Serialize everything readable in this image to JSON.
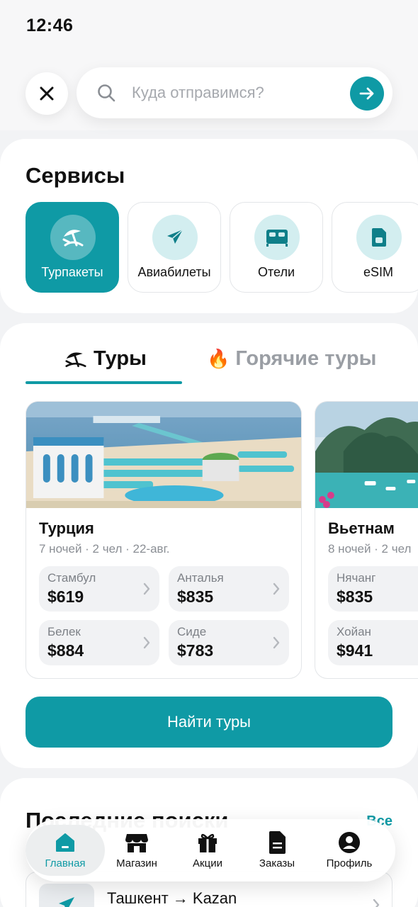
{
  "status_bar": {
    "time": "12:46"
  },
  "search": {
    "placeholder": "Куда отправимся?"
  },
  "services": {
    "title": "Сервисы",
    "items": [
      {
        "label": "Турпакеты",
        "icon": "beach-umbrella-icon",
        "active": true
      },
      {
        "label": "Авиабилеты",
        "icon": "airplane-icon",
        "active": false
      },
      {
        "label": "Отели",
        "icon": "bed-icon",
        "active": false
      },
      {
        "label": "eSIM",
        "icon": "sim-card-icon",
        "active": false
      }
    ]
  },
  "tours_tabs": {
    "tours": "Туры",
    "hot": "Горячие туры",
    "hot_emoji": "🔥"
  },
  "tours": [
    {
      "country": "Турция",
      "meta": "7 ночей · 2 чел · 22-авг.",
      "prices": [
        {
          "city": "Стамбул",
          "price": "$619"
        },
        {
          "city": "Анталья",
          "price": "$835"
        },
        {
          "city": "Белек",
          "price": "$884"
        },
        {
          "city": "Сиде",
          "price": "$783"
        }
      ]
    },
    {
      "country": "Вьетнам",
      "meta": "8 ночей · 2 чел",
      "prices": [
        {
          "city": "Нячанг",
          "price": "$835"
        },
        {
          "city": "Хойан",
          "price": "$941"
        }
      ]
    }
  ],
  "find_button": "Найти туры",
  "recent": {
    "title": "Последние поиски",
    "all_label": "Все",
    "items": [
      {
        "route": "Ташкент → Kazan"
      }
    ]
  },
  "tabbar": [
    {
      "label": "Главная",
      "icon": "home-icon",
      "active": true
    },
    {
      "label": "Магазин",
      "icon": "store-icon",
      "active": false
    },
    {
      "label": "Акции",
      "icon": "gift-icon",
      "active": false
    },
    {
      "label": "Заказы",
      "icon": "document-icon",
      "active": false
    },
    {
      "label": "Профиль",
      "icon": "profile-icon",
      "active": false
    }
  ],
  "colors": {
    "accent": "#0f9aa5",
    "accent_light": "#d3eef0",
    "background": "#f2f3f5"
  }
}
